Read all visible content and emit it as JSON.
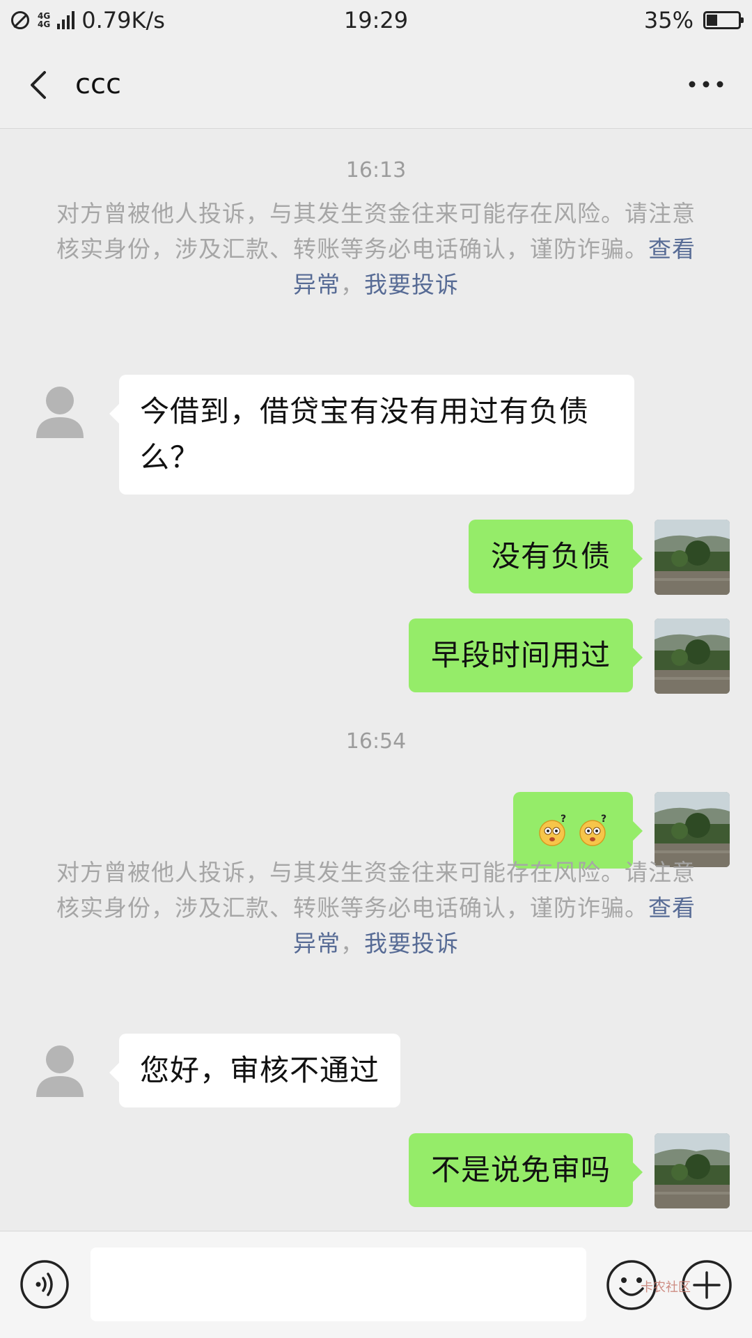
{
  "status_bar": {
    "network": "4G",
    "network2": "4G",
    "speed": "0.79K/s",
    "time": "19:29",
    "battery": "35%",
    "battery_level": 0.35
  },
  "header": {
    "back_icon": "chevron-left-icon",
    "title": "ccc",
    "more_icon": "more-dots-icon"
  },
  "messages": {
    "time1": "16:13",
    "notice1": {
      "text": "对方曾被他人投诉，与其发生资金往来可能存在风险。请注意核实身份，涉及汇款、转账等务必电话确认，谨防诈骗。",
      "link1": "查看异常",
      "sep": "，",
      "link2": "我要投诉"
    },
    "m1": "今借到，借贷宝有没有用过有负债么？",
    "m2": "没有负债",
    "m3": "早段时间用过",
    "time2": "16:54",
    "m4_icon": "confused-face-emoji",
    "notice2": {
      "text": "对方曾被他人投诉，与其发生资金往来可能存在风险。请注意核实身份，涉及汇款、转账等务必电话确认，谨防诈骗。",
      "link1": "查看异常",
      "sep": "，",
      "link2": "我要投诉"
    },
    "m5": "您好，审核不通过",
    "m6": "不是说免审吗"
  },
  "input_bar": {
    "voice_icon": "voice-icon",
    "text_value": "",
    "emoji_icon": "emoji-icon",
    "plus_icon": "plus-icon",
    "watermark": "卡农社区"
  }
}
